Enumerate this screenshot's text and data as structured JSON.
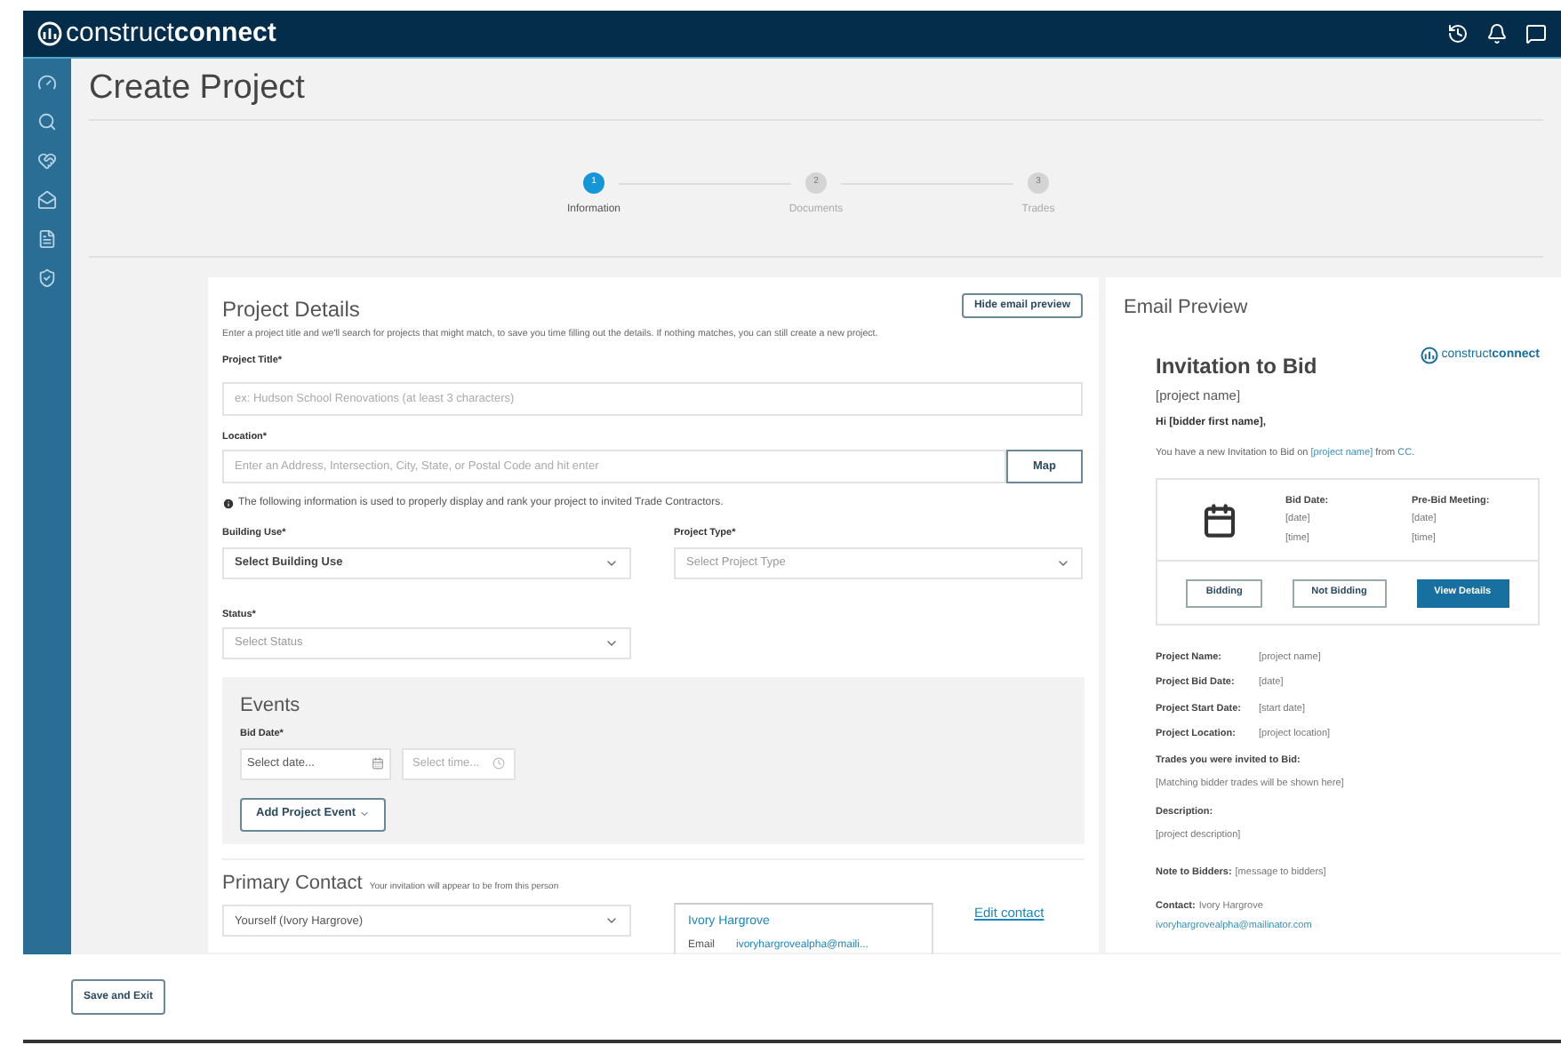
{
  "brand": {
    "light": "construct",
    "bold": "connect"
  },
  "page_title": "Create Project",
  "steps": [
    {
      "number": "1",
      "label": "Information",
      "selected": true
    },
    {
      "number": "2",
      "label": "Documents",
      "selected": false
    },
    {
      "number": "3",
      "label": "Trades",
      "selected": false
    }
  ],
  "project_details": {
    "title": "Project Details",
    "hide_button": "Hide email preview",
    "hint": "Enter a project title and we'll search for projects that might match, to save you time filling out the details. If nothing matches, you can still create a new project.",
    "project_title": {
      "label": "Project Title*",
      "placeholder": "ex: Hudson School Renovations (at least 3 characters)"
    },
    "location": {
      "label": "Location*",
      "placeholder": "Enter an Address, Intersection, City, State, or Postal Code and hit enter",
      "button": "Map"
    },
    "info_note": "The following information is used to properly display and rank your project to invited Trade Contractors.",
    "building_use": {
      "label": "Building Use*",
      "value": "Select Building Use"
    },
    "project_type": {
      "label": "Project Type*",
      "placeholder": "Select Project Type"
    },
    "status": {
      "label": "Status*",
      "placeholder": "Select Status"
    }
  },
  "events": {
    "title": "Events",
    "bid_date_label": "Bid Date*",
    "date_placeholder": "Select date...",
    "time_placeholder": "Select time...",
    "add_button": "Add Project Event"
  },
  "primary_contact": {
    "title": "Primary Contact",
    "note": "Your invitation will appear to be from this person",
    "value": "Yourself (Ivory Hargrove)",
    "card_name": "Ivory Hargrove",
    "email_label": "Email",
    "email": "ivoryhargrovealpha@maili...",
    "edit_link": "Edit contact"
  },
  "email_preview": {
    "title": "Email Preview",
    "logo": {
      "light": "construct",
      "bold": "connect"
    },
    "heading": "Invitation to Bid",
    "subheading": "[project name]",
    "greeting": "Hi [bidder first name],",
    "intro": [
      {
        "text": "You have a new Invitation to Bid on ",
        "link": false
      },
      {
        "text": "[project name]",
        "link": true
      },
      {
        "text": " from ",
        "link": false
      },
      {
        "text": "CC",
        "link": true
      },
      {
        "text": ".",
        "link": false
      }
    ],
    "date_columns": [
      {
        "label": "Bid Date:",
        "date": "[date]",
        "time": "[time]"
      },
      {
        "label": "Pre-Bid Meeting:",
        "date": "[date]",
        "time": "[time]"
      }
    ],
    "buttons": [
      {
        "label": "Bidding",
        "primary": false
      },
      {
        "label": "Not Bidding",
        "primary": false
      },
      {
        "label": "View Details",
        "primary": true
      }
    ],
    "details": [
      {
        "label": "Project Name:",
        "value": "[project name]"
      },
      {
        "label": "Project Bid Date:",
        "value": "[date]"
      },
      {
        "label": "Project Start Date:",
        "value": "[start date]"
      },
      {
        "label": "Project Location:",
        "value": "[project location]"
      }
    ],
    "trades": {
      "label": "Trades you were invited to Bid:",
      "value": "[Matching bidder trades will be shown here]"
    },
    "description": {
      "label": "Description:",
      "value": "[project description]"
    },
    "note": {
      "label": "Note to Bidders:",
      "value": "[message to bidders]"
    },
    "contact": {
      "label": "Contact:",
      "name": "Ivory Hargrove",
      "email": "ivoryhargrovealpha@mailinator.com"
    }
  },
  "footer": {
    "save_button": "Save and Exit"
  }
}
